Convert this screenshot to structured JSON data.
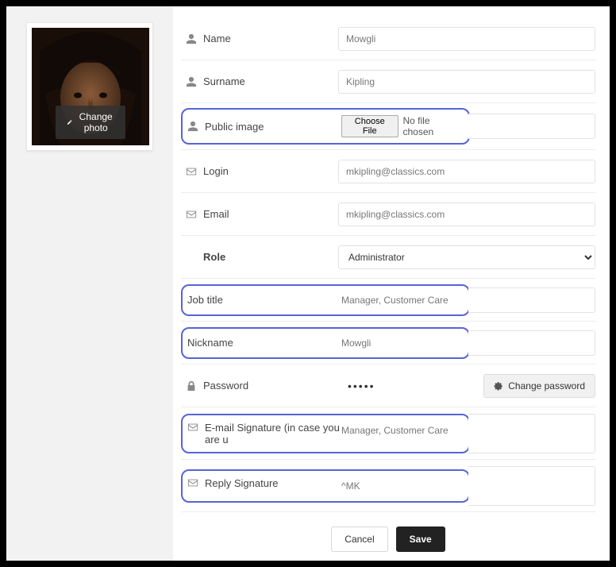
{
  "sidebar": {
    "change_photo_label": "Change photo"
  },
  "fields": {
    "name": {
      "label": "Name",
      "value": "Mowgli"
    },
    "surname": {
      "label": "Surname",
      "value": "Kipling"
    },
    "public_image": {
      "label": "Public image",
      "button": "Choose File",
      "status": "No file chosen"
    },
    "login": {
      "label": "Login",
      "value": "mkipling@classics.com"
    },
    "email": {
      "label": "Email",
      "value": "mkipling@classics.com"
    },
    "role": {
      "label": "Role",
      "value": "Administrator"
    },
    "job_title": {
      "label": "Job title",
      "value": "Manager, Customer Care"
    },
    "nickname": {
      "label": "Nickname",
      "value": "Mowgli"
    },
    "password": {
      "label": "Password",
      "masked": "•••••",
      "change_button": "Change password"
    },
    "email_signature": {
      "label": "E-mail Signature (in case you are u",
      "value": "Manager, Customer Care"
    },
    "reply_signature": {
      "label": "Reply Signature",
      "value": "^MK"
    }
  },
  "actions": {
    "cancel": "Cancel",
    "save": "Save"
  }
}
